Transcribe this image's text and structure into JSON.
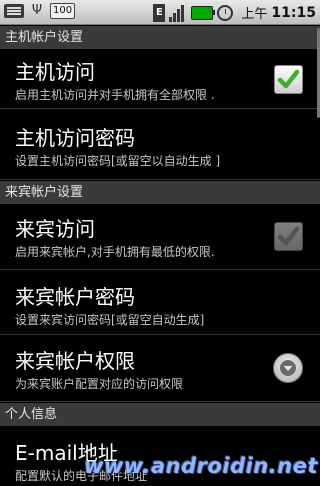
{
  "status_bar": {
    "battery_text": "100",
    "network_letter": "E",
    "time_prefix": "上午",
    "clock": "11:15"
  },
  "sections": [
    {
      "header": "主机帐户设置"
    },
    {
      "header": "来宾帐户设置"
    },
    {
      "header": "个人信息"
    }
  ],
  "prefs": {
    "host_access": {
      "title": "主机访问",
      "summary": "启用主机访问并对手机拥有全部权限 .",
      "checked": true
    },
    "host_password": {
      "title": "主机访问密码",
      "summary": "设置主机访问密码[或留空以自动生成 ]"
    },
    "guest_access": {
      "title": "来宾访问",
      "summary": "启用来宾帐户,对手机拥有最低的权限.",
      "checked": true,
      "enabled": false
    },
    "guest_password": {
      "title": "来宾帐户密码",
      "summary": "设置来宾访问密码[或留空自动生成]"
    },
    "guest_permissions": {
      "title": "来宾帐户权限",
      "summary": "为来宾账户配置对应的访问权限"
    },
    "email": {
      "title": "E-mail地址",
      "summary": "配置默认的电子邮件地址"
    }
  },
  "watermark": "www.androidin.net",
  "colors": {
    "check_green": "#3fae2a",
    "section_bg": "#3a3a3a"
  }
}
